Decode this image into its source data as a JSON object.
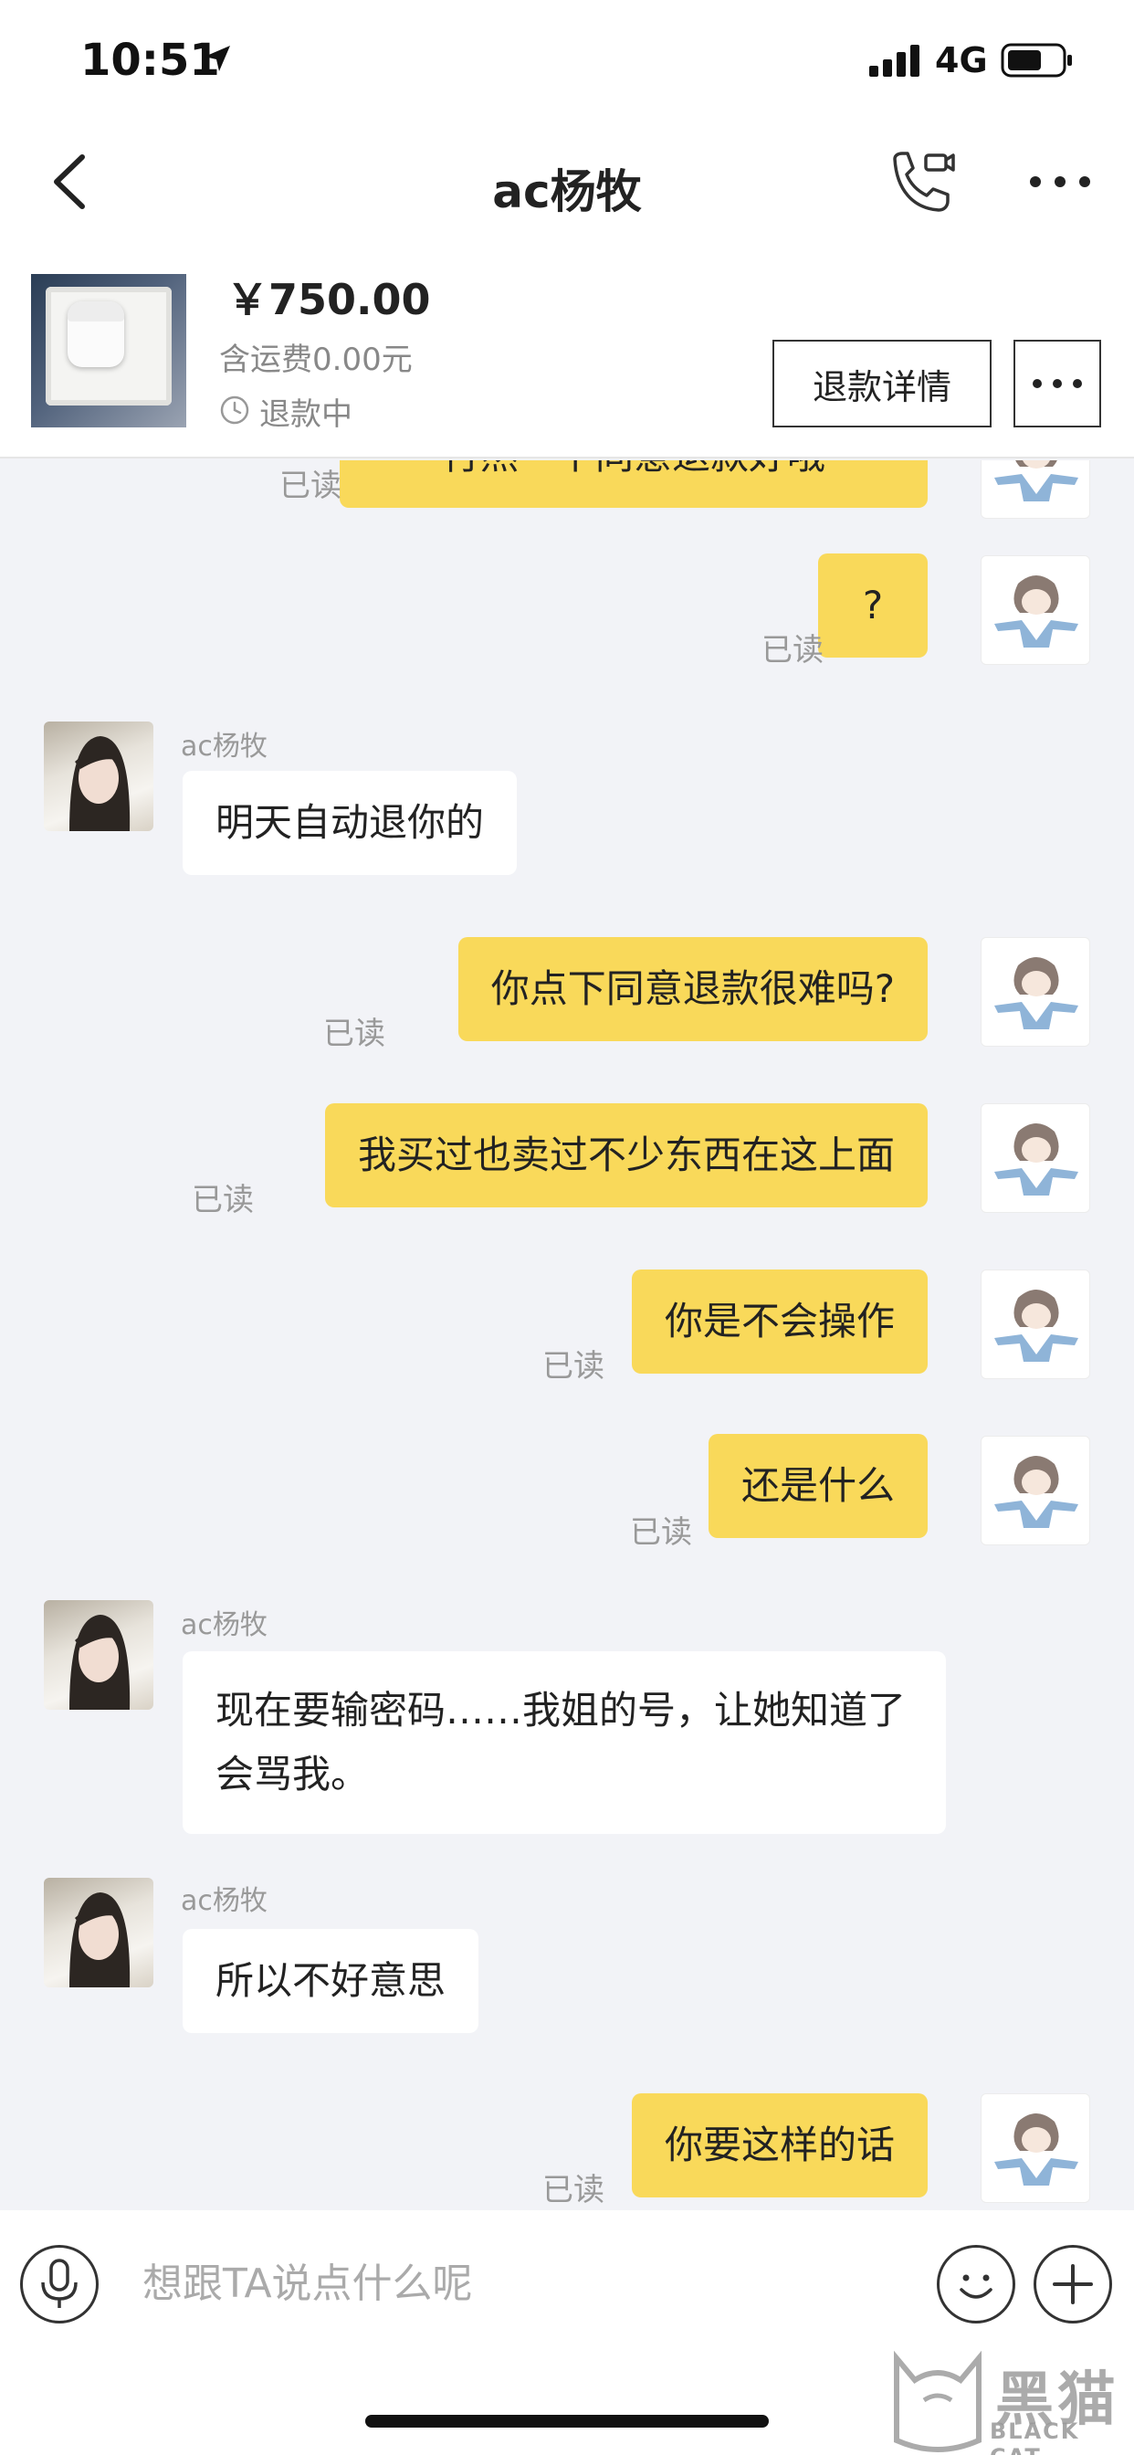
{
  "status_bar": {
    "time": "10:51",
    "network": "4G"
  },
  "nav": {
    "title": "ac杨牧"
  },
  "order": {
    "price": "￥750.00",
    "shipping": "含运费0.00元",
    "status": "退款中",
    "refund_button": "退款详情"
  },
  "chat": {
    "read_label": "已读",
    "other_name": "ac杨牧",
    "messages": [
      {
        "from": "me",
        "text": "行然一下同意退款好哦"
      },
      {
        "from": "me",
        "text": "?"
      },
      {
        "from": "other",
        "text": "明天自动退你的"
      },
      {
        "from": "me",
        "text": "你点下同意退款很难吗?"
      },
      {
        "from": "me",
        "text": "我买过也卖过不少东西在这上面"
      },
      {
        "from": "me",
        "text": "你是不会操作"
      },
      {
        "from": "me",
        "text": "还是什么"
      },
      {
        "from": "other",
        "text": "现在要输密码……我姐的号，让她知道了会骂我。"
      },
      {
        "from": "other",
        "text": "所以不好意思"
      },
      {
        "from": "me",
        "text": "你要这样的话"
      }
    ]
  },
  "input": {
    "placeholder": "想跟TA说点什么呢"
  },
  "watermark": {
    "cn": "黑猫",
    "en": "BLACK CAT"
  },
  "colors": {
    "my_bubble": "#f9d95a",
    "other_bubble": "#ffffff",
    "background": "#f2f3f7"
  }
}
